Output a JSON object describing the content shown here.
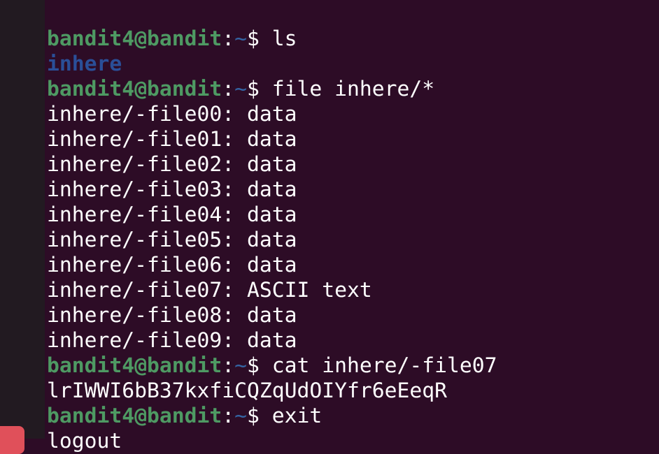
{
  "prompt": {
    "user_host": "bandit4@bandit",
    "sep": ":",
    "path": "~",
    "symbol": "$ "
  },
  "lines": [
    {
      "type": "cmd",
      "text": "ls"
    },
    {
      "type": "dir",
      "text": "inhere"
    },
    {
      "type": "cmd",
      "text": "file inhere/*"
    },
    {
      "type": "out",
      "text": "inhere/-file00: data"
    },
    {
      "type": "out",
      "text": "inhere/-file01: data"
    },
    {
      "type": "out",
      "text": "inhere/-file02: data"
    },
    {
      "type": "out",
      "text": "inhere/-file03: data"
    },
    {
      "type": "out",
      "text": "inhere/-file04: data"
    },
    {
      "type": "out",
      "text": "inhere/-file05: data"
    },
    {
      "type": "out",
      "text": "inhere/-file06: data"
    },
    {
      "type": "out",
      "text": "inhere/-file07: ASCII text"
    },
    {
      "type": "out",
      "text": "inhere/-file08: data"
    },
    {
      "type": "out",
      "text": "inhere/-file09: data"
    },
    {
      "type": "cmd",
      "text": "cat inhere/-file07"
    },
    {
      "type": "out",
      "text": "lrIWWI6bB37kxfiCQZqUdOIYfr6eEeqR"
    },
    {
      "type": "cmd",
      "text": "exit"
    },
    {
      "type": "out",
      "text": "logout"
    }
  ],
  "colors": {
    "background": "#2d0c26",
    "prompt_user": "#4e9a63",
    "prompt_path": "#3465a4",
    "directory": "#2a4f98",
    "dock_button": "#e0505a"
  }
}
